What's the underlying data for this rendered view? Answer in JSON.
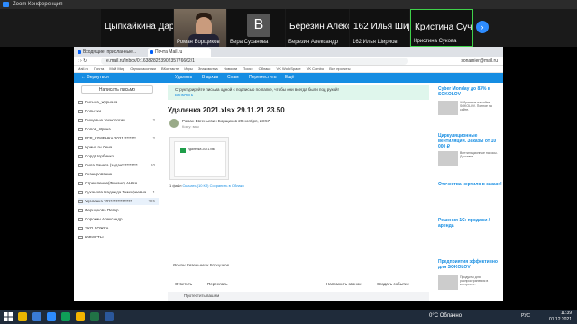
{
  "zoom": {
    "title": "Zoom Конференция",
    "participants": [
      {
        "name": "Цыпкайкина Дарья",
        "type": "text"
      },
      {
        "name": "Роман Борщиков",
        "type": "video"
      },
      {
        "name": "Вера Суханова",
        "type": "avatar",
        "initial": "B"
      },
      {
        "name": "Березин Александр",
        "type": "text",
        "big": "Березин Алекс..."
      },
      {
        "name": "162 Илья Шириов",
        "type": "text",
        "big": "162 Илья Ширцов"
      },
      {
        "name": "Кристина Сукова",
        "type": "text",
        "big": "Кристина Сучк..."
      }
    ],
    "next_arrow": "›"
  },
  "browser": {
    "tabs": [
      "Входящие: присланные...",
      "Почта Mail.ru"
    ],
    "url": "e.mail.ru/inbox/0:16382825390235776662/1",
    "account": "sonamier@mail.ru",
    "bookmarks": [
      "Mail.ru",
      "Почта",
      "Мой Мир",
      "Одноклассники",
      "ВКонтакте",
      "Игры",
      "Знакомства",
      "Новости",
      "Поиск",
      "Облако",
      "VK WorkSpace",
      "VK Combo",
      "Все проекты"
    ]
  },
  "mailbar": {
    "back": "← Вернуться",
    "delete": "Удалить",
    "archive": "В архив",
    "spam": "Спам",
    "move": "Переместить",
    "more": "Ещё"
  },
  "sidebar": {
    "compose": "Написать письмо",
    "folders": [
      {
        "label": "Письма_журнала",
        "count": ""
      },
      {
        "label": "Попытки",
        "count": ""
      },
      {
        "label": "Пищевые технологии",
        "count": "2"
      },
      {
        "label": "Попов_Ирина",
        "count": ""
      },
      {
        "label": "РГР_КЛИЕНКА 2021********",
        "count": "2"
      },
      {
        "label": "Ирина гн Лена",
        "count": ""
      },
      {
        "label": "СордШорбинко",
        "count": ""
      },
      {
        "label": "Сила Зачета (задач**********",
        "count": "10"
      },
      {
        "label": "Сканирование",
        "count": ""
      },
      {
        "label": "Стремление(Финанс) АННА",
        "count": ""
      },
      {
        "label": "Суханова Надежда Тимофеевна",
        "count": "1"
      },
      {
        "label": "Удаленка 2021************",
        "count": "315"
      },
      {
        "label": "Фершукова Петер",
        "count": ""
      },
      {
        "label": "Сорокин Александр",
        "count": ""
      },
      {
        "label": "ЭКО ЛОЖКА",
        "count": ""
      },
      {
        "label": "ЮРИСТЫ",
        "count": ""
      }
    ]
  },
  "message": {
    "banner_text": "Структурируйте письма одной с подписью по папке, чтобы они всегда были под рукой!",
    "banner_link": "Включить",
    "subject": "Удаленка 2021.xlsx 29.11.21 23.50",
    "sender": "Роман Евгеньевич Борщиков  29 ноября, 23:57",
    "to": "Кому: вам",
    "attachment_name": "Удаленка 2021.xlsx",
    "attach_count": "1 файл",
    "attach_download": "Скачать (10 Кб)",
    "attach_save": "Сохранить в Облако",
    "signature": "Роман Евгеньевич Борщиков",
    "reply": "Ответить",
    "forward": "Переслать",
    "reminder": "Напомнить звонок",
    "create_event": "Создать событие",
    "quick_reply": "Протестить вашим"
  },
  "ads": {
    "heading1": "Cyber Monday до 83% в SOKOLOV",
    "text1": "Избранные на сайте SOKOLOV. Полное на сайте.",
    "heading2": "Циркуляционные вентиляции. Заказы от 10 000 ₽",
    "text2": "Вентиляционные насосы. Доставка.",
    "heading3": "Отечества чертило в заказе!",
    "heading4": "Решения 1С: продажи / аренда",
    "heading5": "Предприятия эффективно для SOKOLOV",
    "text5": "Продукты для распространения в интернете."
  },
  "taskbar": {
    "weather": "0°C Облачно",
    "lang": "РУС",
    "time": "11:39",
    "date": "01.12.2021"
  }
}
